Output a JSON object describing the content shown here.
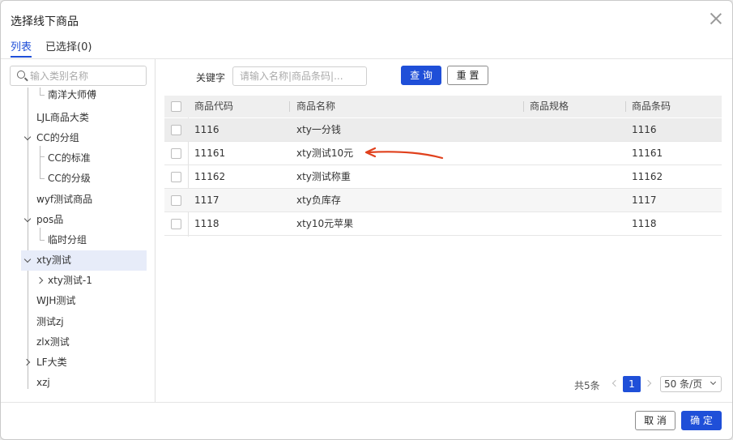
{
  "dialog": {
    "title": "选择线下商品"
  },
  "tabs": [
    {
      "label": "列表",
      "active": true
    },
    {
      "label": "已选择(0)",
      "active": false
    }
  ],
  "tree": {
    "search_placeholder": "输入类别名称",
    "nodes": [
      {
        "label": "南洋大师傅",
        "expand": "none",
        "depth": 1
      },
      {
        "label": "LJL商品大类",
        "expand": "none",
        "depth": 0
      },
      {
        "label": "CC的分组",
        "expand": "expanded",
        "depth": 0
      },
      {
        "label": "CC的标准",
        "expand": "none",
        "depth": 1
      },
      {
        "label": "CC的分级",
        "expand": "none",
        "depth": 1
      },
      {
        "label": "wyf测试商品",
        "expand": "none",
        "depth": 0
      },
      {
        "label": "pos品",
        "expand": "expanded",
        "depth": 0
      },
      {
        "label": "临时分组",
        "expand": "none",
        "depth": 1
      },
      {
        "label": "xty测试",
        "expand": "expanded",
        "depth": 0,
        "selected": true
      },
      {
        "label": "xty测试-1",
        "expand": "collapsed",
        "depth": 1
      },
      {
        "label": "WJH测试",
        "expand": "none",
        "depth": 0
      },
      {
        "label": "测试zj",
        "expand": "none",
        "depth": 0
      },
      {
        "label": "zlx测试",
        "expand": "none",
        "depth": 0
      },
      {
        "label": "LF大类",
        "expand": "collapsed",
        "depth": 0
      },
      {
        "label": "xzj",
        "expand": "none",
        "depth": 0
      }
    ]
  },
  "filter": {
    "keyword_label": "关键字",
    "keyword_placeholder": "请输入名称|商品条码|...",
    "keyword_value": "",
    "search_button": "查 询",
    "reset_button": "重 置"
  },
  "table": {
    "columns": [
      "商品代码",
      "商品名称",
      "商品规格",
      "商品条码"
    ],
    "rows": [
      {
        "code": "1116",
        "name": "xty一分钱",
        "spec": "",
        "barcode": "1116"
      },
      {
        "code": "11161",
        "name": "xty测试10元",
        "spec": "",
        "barcode": "11161"
      },
      {
        "code": "11162",
        "name": "xty测试称重",
        "spec": "",
        "barcode": "11162"
      },
      {
        "code": "1117",
        "name": "xty负库存",
        "spec": "",
        "barcode": "1117"
      },
      {
        "code": "1118",
        "name": "xty10元苹果",
        "spec": "",
        "barcode": "1118"
      }
    ]
  },
  "pagination": {
    "total": "共5条",
    "current_page": "1",
    "page_size": "50 条/页"
  },
  "footer": {
    "cancel_button": "取 消",
    "confirm_button": "确 定"
  },
  "colors": {
    "primary": "#1f4fd8",
    "annotation_arrow": "#e0401c"
  }
}
